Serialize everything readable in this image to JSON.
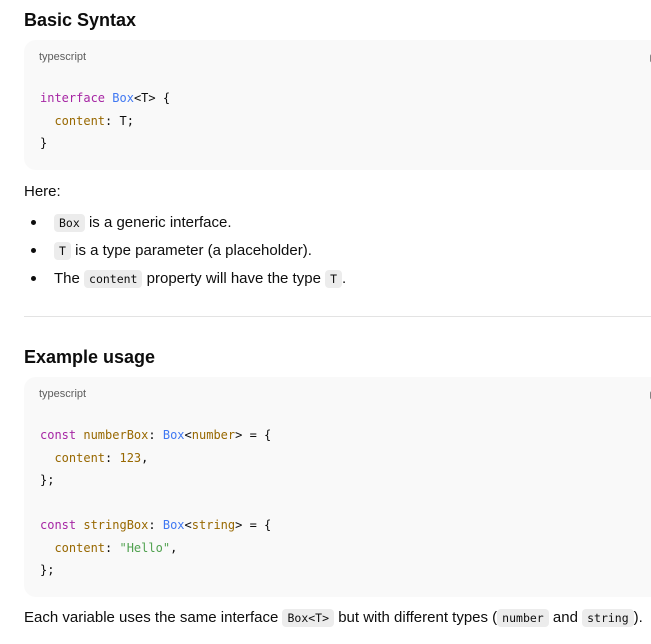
{
  "sections": {
    "basic": {
      "heading": "Basic Syntax",
      "code": {
        "language": "typescript",
        "lines": [
          {
            "kw": "interface",
            "ty": "Box",
            "rest": "<T> {"
          },
          {
            "prop": "content",
            "rest": ": T;"
          },
          {
            "rest": "}"
          }
        ]
      },
      "here": "Here:",
      "bullets": [
        {
          "before": "",
          "code": "Box",
          "after": " is a generic interface."
        },
        {
          "before": "",
          "code": "T",
          "after": " is a type parameter (a placeholder)."
        },
        {
          "before": "The ",
          "code": "content",
          "middle": " property will have the type ",
          "code2": "T",
          "after": "."
        }
      ]
    },
    "example": {
      "heading": "Example usage",
      "code": {
        "language": "typescript",
        "number_box": {
          "kw": "const",
          "var": "numberBox",
          "ty": "Box",
          "typearg": "number",
          "prop": "content",
          "value": "123"
        },
        "string_box": {
          "kw": "const",
          "var": "stringBox",
          "ty": "Box",
          "typearg": "string",
          "prop": "content",
          "value": "\"Hello\""
        }
      },
      "summary": {
        "before": "Each variable uses the same interface ",
        "code1": "Box<T>",
        "middle": " but with different types (",
        "code2": "number",
        "and": " and ",
        "code3": "string",
        "after": ")."
      }
    }
  },
  "icons": {
    "copy": "copy-icon"
  },
  "colors": {
    "code_bg": "#f9f9f9",
    "keyword": "#a626a4",
    "type": "#4078f2",
    "property": "#986801",
    "string": "#50a14f",
    "inline_code_bg": "#ececec",
    "divider": "#e3e3e3"
  }
}
